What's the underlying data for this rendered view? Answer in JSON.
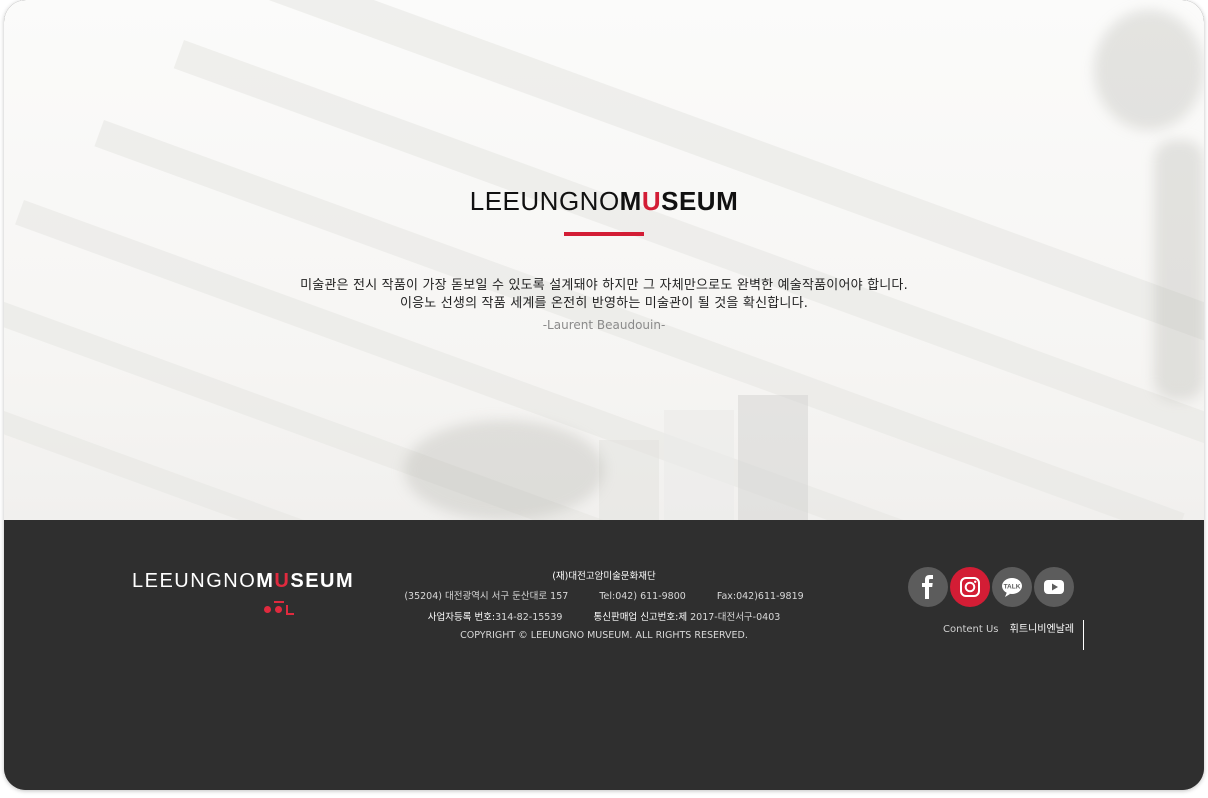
{
  "hero": {
    "logo": {
      "part1": "LEEUNGNO",
      "part2": "M",
      "part3": "U",
      "part4": "SEUM"
    },
    "quote_line1": "미술관은 전시 작품이 가장 돋보일 수 있도록 설계돼야 하지만 그 자체만으로도 완벽한 예술작품이어야 합니다.",
    "quote_line2": "이응노 선생의 작품 세계를 온전히 반영하는 미술관이 될 것을 확신합니다.",
    "quote_author": "-Laurent Beaudouin-"
  },
  "footer": {
    "logo": {
      "part1": "LEEUNGNO",
      "part2": "M",
      "part3": "U",
      "part4": "SEUM"
    },
    "org": "(재)대전고암미술문화재단",
    "address": "(35204) 대전광역시 서구 둔산대로 157",
    "tel": "Tel:042) 611-9800",
    "fax": "Fax:042)611-9819",
    "biz_label": "사업자등록 번호:",
    "biz_no": "314-82-15539",
    "mail_label": "통신판매업 신고번호:제 ",
    "mail_no": "2017-대전서구-0403",
    "copyright": "COPYRIGHT © LEEUNGNO MUSEUM. ALL RIGHTS RESERVED.",
    "social": [
      {
        "icon": "facebook-icon"
      },
      {
        "icon": "instagram-icon"
      },
      {
        "icon": "kakaotalk-icon",
        "label": "TALK"
      },
      {
        "icon": "youtube-icon"
      }
    ],
    "links": {
      "contact": "Content Us",
      "credit": "휘트니비엔날레"
    },
    "accent_color": "#d31d35"
  }
}
